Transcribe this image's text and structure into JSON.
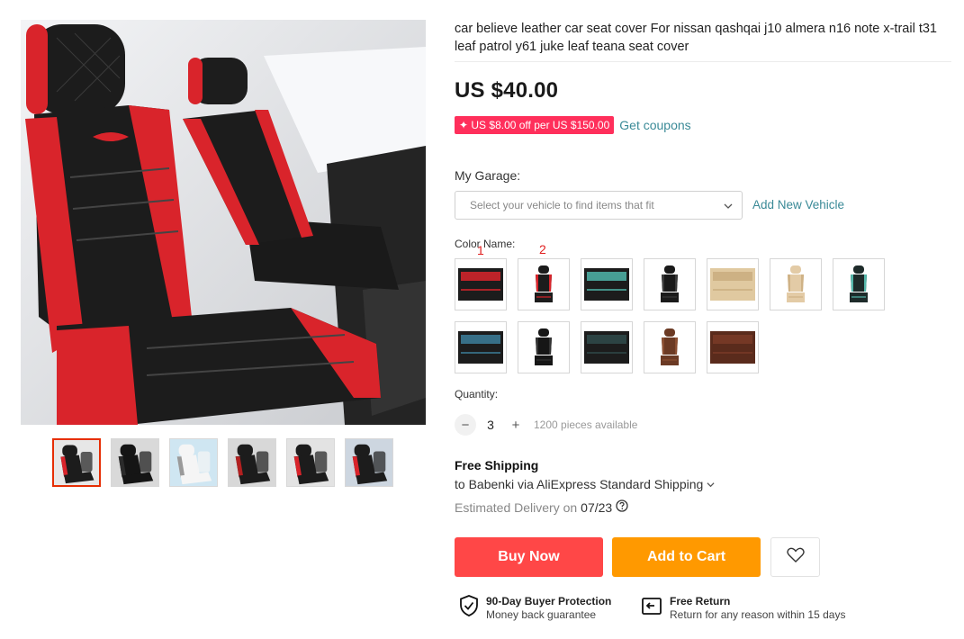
{
  "product": {
    "title": "car believe leather car seat cover For nissan qashqai j10 almera n16 note x-trail t31 leaf patrol y61 juke leaf teana seat cover",
    "price": "US $40.00",
    "coupon_badge": "✦ US $8.00 off per US $150.00",
    "coupon_link": "Get coupons"
  },
  "garage": {
    "label": "My Garage:",
    "placeholder": "Select your vehicle to find items that fit",
    "add_link": "Add New Vehicle"
  },
  "color": {
    "label": "Color Name:",
    "annotations": [
      "1",
      "2"
    ],
    "swatches": [
      {
        "name": "black-red-set",
        "colors": [
          "#1c1c1c",
          "#d9242b"
        ]
      },
      {
        "name": "black-red-single",
        "colors": [
          "#1c1c1c",
          "#d9242b"
        ]
      },
      {
        "name": "black-teal-set",
        "colors": [
          "#1c1c1c",
          "#4fb5a9"
        ]
      },
      {
        "name": "black-single",
        "colors": [
          "#1a1a1a",
          "#3a3a3a"
        ]
      },
      {
        "name": "beige-set",
        "colors": [
          "#e0c9a0",
          "#c9ad7f"
        ]
      },
      {
        "name": "beige-single",
        "colors": [
          "#e3cba6",
          "#cfb286"
        ]
      },
      {
        "name": "black-teal-single",
        "colors": [
          "#1e2b2a",
          "#55b7aa"
        ]
      },
      {
        "name": "black-blue-set",
        "colors": [
          "#1c1c1c",
          "#3c7e9a"
        ]
      },
      {
        "name": "black-single-2",
        "colors": [
          "#161616",
          "#333333"
        ]
      },
      {
        "name": "black-set-2",
        "colors": [
          "#1c1c1c",
          "#2f4a4a"
        ]
      },
      {
        "name": "brown-single",
        "colors": [
          "#6b3a24",
          "#8a4e31"
        ]
      },
      {
        "name": "brown-set",
        "colors": [
          "#5a2b1c",
          "#7a3b27"
        ]
      }
    ]
  },
  "quantity": {
    "label": "Quantity:",
    "minus": "−",
    "value": "3",
    "plus": "+",
    "available": "1200 pieces available"
  },
  "shipping": {
    "title": "Free Shipping",
    "to": "to Babenki via AliExpress Standard Shipping",
    "eta_prefix": "Estimated Delivery on",
    "eta_date": "07/23"
  },
  "actions": {
    "buy_now": "Buy Now",
    "add_to_cart": "Add to Cart"
  },
  "guarantees": {
    "protection_title": "90-Day Buyer Protection",
    "protection_sub": "Money back guarantee",
    "return_title": "Free Return",
    "return_sub": "Return for any reason within 15 days"
  },
  "gallery": {
    "thumbnails": [
      "red-black-seat",
      "black-seat-interior",
      "cover-pack",
      "black-front-seats",
      "red-seat-closeup",
      "red-seat-car"
    ],
    "active_index": 0
  },
  "colors": {
    "accent_red": "#ff4747",
    "accent_orange": "#ff9900",
    "coupon_pink": "#ff2f5b",
    "link_teal": "#3a8a97"
  }
}
